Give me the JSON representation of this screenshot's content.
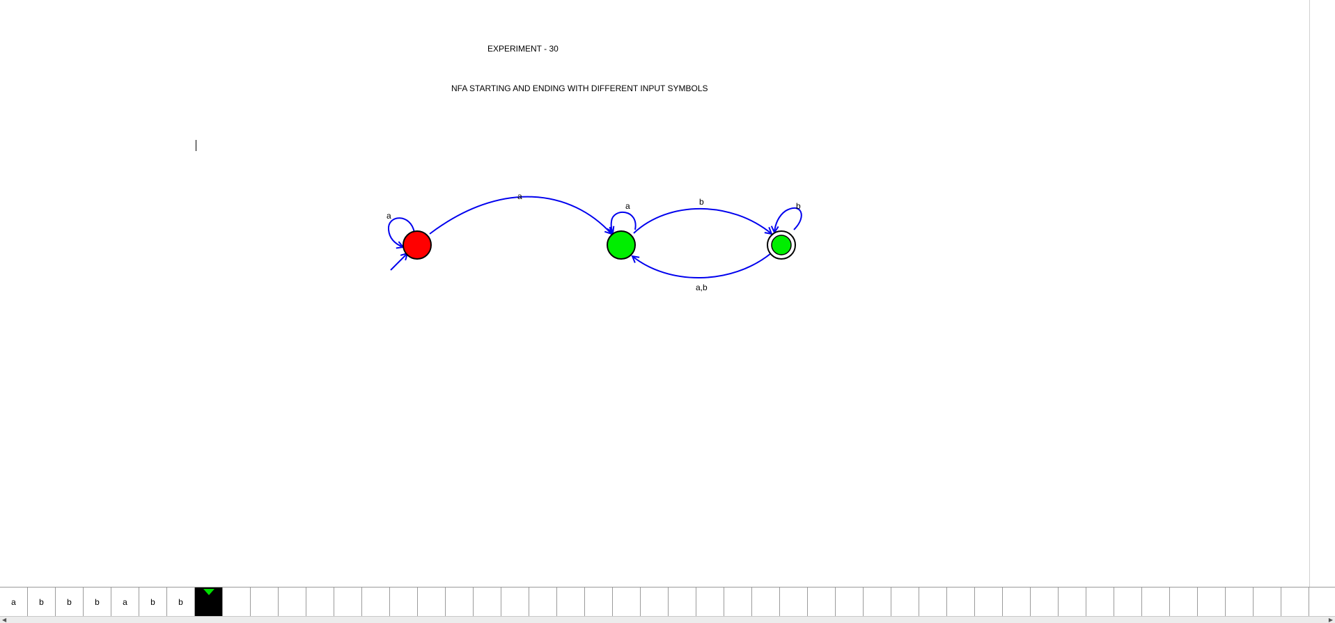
{
  "header": {
    "title": "EXPERIMENT - 30",
    "subtitle": "NFA STARTING AND ENDING WITH DIFFERENT INPUT SYMBOLS"
  },
  "diagram": {
    "states": [
      {
        "id": "q0",
        "initial": true,
        "final": false,
        "color": "#ff0000"
      },
      {
        "id": "q1",
        "initial": false,
        "final": false,
        "color": "#00ee00"
      },
      {
        "id": "q2",
        "initial": false,
        "final": true,
        "color": "#00ee00"
      }
    ],
    "transitions": [
      {
        "from": "q0",
        "to": "q0",
        "label": "a"
      },
      {
        "from": "q0",
        "to": "q1",
        "label": "a"
      },
      {
        "from": "q1",
        "to": "q1",
        "label": "a"
      },
      {
        "from": "q1",
        "to": "q2",
        "label": "b"
      },
      {
        "from": "q2",
        "to": "q2",
        "label": "b"
      },
      {
        "from": "q2",
        "to": "q1",
        "label": "a,b"
      }
    ],
    "edge_color": "#0000ee"
  },
  "tape": {
    "symbols": [
      "a",
      "b",
      "b",
      "b",
      "a",
      "b",
      "b"
    ],
    "head_index": 7,
    "head_color": "#00e000",
    "total_cells": 48
  }
}
